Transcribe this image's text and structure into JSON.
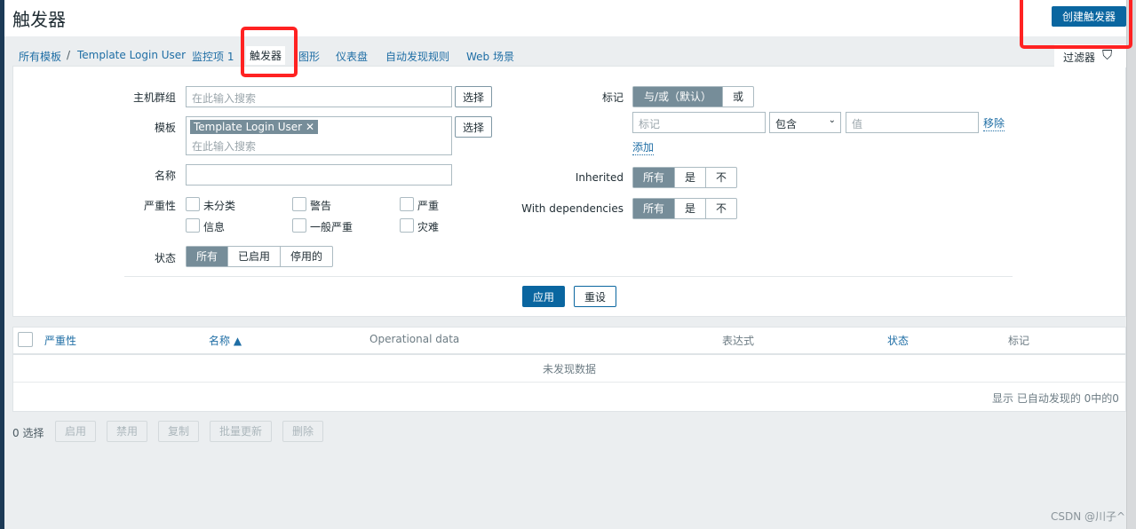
{
  "header": {
    "title": "触发器",
    "create_button": "创建触发器"
  },
  "nav": {
    "breadcrumb_root": "所有模板",
    "separator": "/",
    "template": "Template Login User",
    "items": "监控项 1",
    "triggers": "触发器",
    "graphs": "图形",
    "dashboards": "仪表盘",
    "discovery": "自动发现规则",
    "web": "Web 场景",
    "filter_tab": "过滤器"
  },
  "filter": {
    "host_groups_label": "主机群组",
    "host_groups_placeholder": "在此输入搜索",
    "select": "选择",
    "template_label": "模板",
    "template_chip": "Template Login User",
    "template_placeholder": "在此输入搜索",
    "name_label": "名称",
    "name_value": "",
    "severity_label": "严重性",
    "severities": [
      "未分类",
      "警告",
      "严重",
      "信息",
      "一般严重",
      "灾难"
    ],
    "status_label": "状态",
    "status_options": [
      "所有",
      "已启用",
      "停用的"
    ],
    "tags_label": "标记",
    "tag_logic": [
      "与/或（默认）",
      "或"
    ],
    "tag_placeholder": "标记",
    "tag_operator": "包含",
    "tag_value_placeholder": "值",
    "remove": "移除",
    "add": "添加",
    "inherited_label": "Inherited",
    "with_dependencies_label": "With dependencies",
    "yes_no": [
      "所有",
      "是",
      "不"
    ],
    "apply": "应用",
    "reset": "重设"
  },
  "table": {
    "columns": [
      "严重性",
      "名称 ▲",
      "Operational data",
      "表达式",
      "状态",
      "标记"
    ],
    "empty": "未发现数据",
    "footer": "显示 已自动发现的 0中的0"
  },
  "actions": {
    "selected": "0 选择",
    "buttons": [
      "启用",
      "禁用",
      "复制",
      "批量更新",
      "删除"
    ]
  },
  "watermark": "CSDN @川子^",
  "colors": {
    "primary": "#0a66a0",
    "link": "#1f6ea5",
    "segment_active": "#768d99",
    "annotation": "#ff2222"
  }
}
